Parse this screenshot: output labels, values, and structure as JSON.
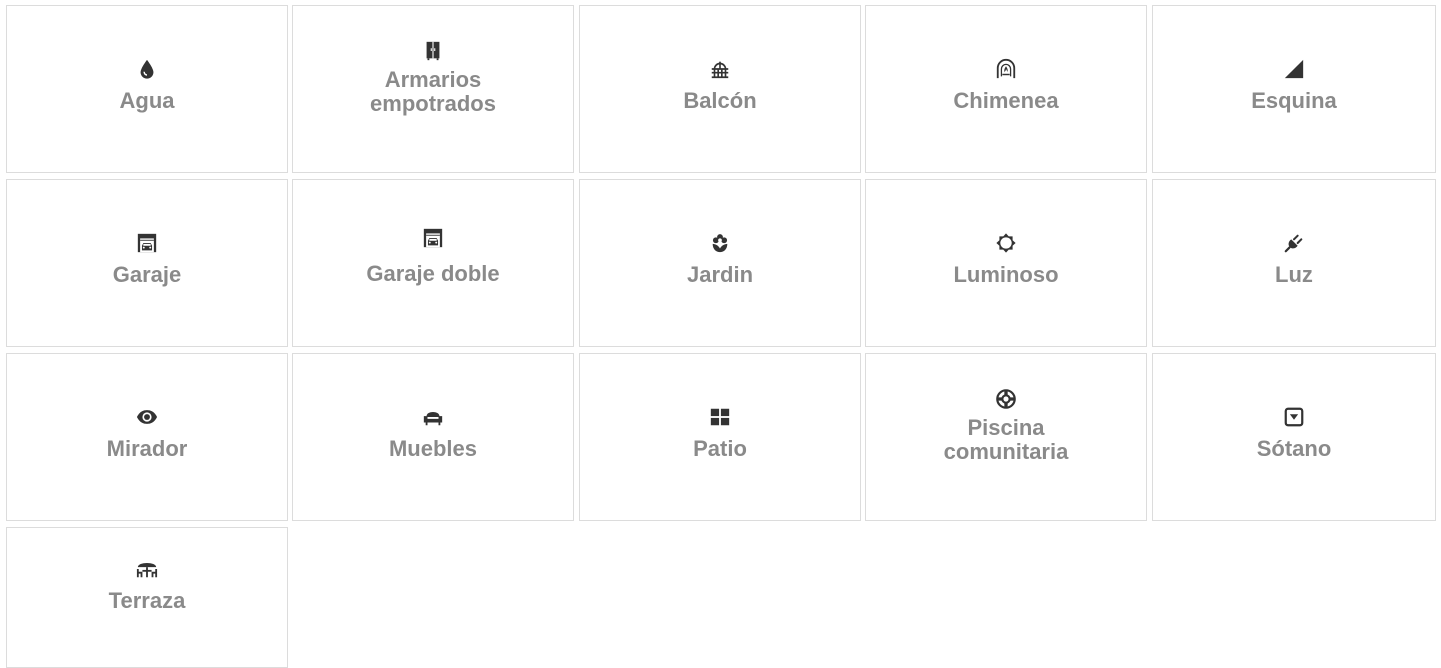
{
  "features": [
    {
      "label": "Agua",
      "icon": "water-drop-icon"
    },
    {
      "label": "Armarios\nempotrados",
      "icon": "wardrobe-icon"
    },
    {
      "label": "Balcón",
      "icon": "balcony-icon"
    },
    {
      "label": "Chimenea",
      "icon": "fireplace-icon"
    },
    {
      "label": "Esquina",
      "icon": "corner-icon"
    },
    {
      "label": "Garaje",
      "icon": "garage-icon"
    },
    {
      "label": "Garaje doble",
      "icon": "double-garage-icon"
    },
    {
      "label": "Jardin",
      "icon": "flower-icon"
    },
    {
      "label": "Luminoso",
      "icon": "sun-icon"
    },
    {
      "label": "Luz",
      "icon": "plug-icon"
    },
    {
      "label": "Mirador",
      "icon": "eye-icon"
    },
    {
      "label": "Muebles",
      "icon": "armchair-icon"
    },
    {
      "label": "Patio",
      "icon": "grid-squares-icon"
    },
    {
      "label": "Piscina\ncomunitaria",
      "icon": "lifebuoy-icon"
    },
    {
      "label": "Sótano",
      "icon": "basement-icon"
    },
    {
      "label": "Terraza",
      "icon": "terrace-table-icon"
    }
  ],
  "colors": {
    "icon": "#333333",
    "label": "#8a8a8a",
    "border": "#dcdcdc",
    "background": "#ffffff"
  }
}
